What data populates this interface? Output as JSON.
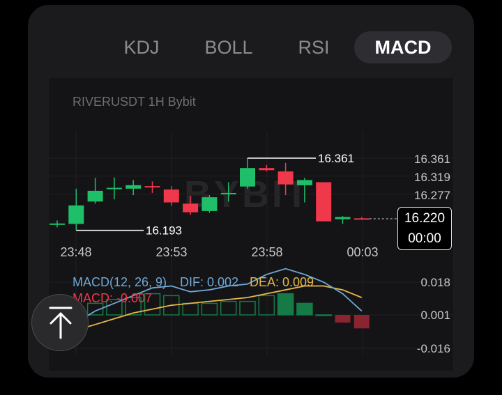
{
  "tabs": [
    {
      "label": "KDJ",
      "active": false
    },
    {
      "label": "BOLL",
      "active": false
    },
    {
      "label": "RSI",
      "active": false
    },
    {
      "label": "MACD",
      "active": true
    }
  ],
  "chart_header": {
    "symbol_label": "RIVERUSDT 1H Bybit"
  },
  "watermark": "BYBIT",
  "price_tag": {
    "price": "16.220",
    "countdown": "00:00"
  },
  "colors": {
    "up": "#1fbf6a",
    "down": "#f0384b",
    "dif": "#6ea9d6",
    "dea": "#e8b84a",
    "macd_label": "#f0384b"
  },
  "chart_data": [
    {
      "type": "candlestick",
      "title": "RIVERUSDT 1H Bybit",
      "x_ticks": [
        "23:48",
        "23:53",
        "23:58",
        "00:03"
      ],
      "y_ticks": [
        "16.361",
        "16.319",
        "16.277",
        "16.220"
      ],
      "high_label": "16.361",
      "low_label": "16.193",
      "candles": [
        {
          "o": 16.209,
          "h": 16.216,
          "l": 16.2,
          "c": 16.209
        },
        {
          "o": 16.208,
          "h": 16.29,
          "l": 16.193,
          "c": 16.251
        },
        {
          "o": 16.26,
          "h": 16.315,
          "l": 16.255,
          "c": 16.285
        },
        {
          "o": 16.292,
          "h": 16.316,
          "l": 16.265,
          "c": 16.292
        },
        {
          "o": 16.29,
          "h": 16.31,
          "l": 16.275,
          "c": 16.298
        },
        {
          "o": 16.296,
          "h": 16.307,
          "l": 16.28,
          "c": 16.293
        },
        {
          "o": 16.288,
          "h": 16.296,
          "l": 16.25,
          "c": 16.258
        },
        {
          "o": 16.255,
          "h": 16.273,
          "l": 16.229,
          "c": 16.235
        },
        {
          "o": 16.238,
          "h": 16.275,
          "l": 16.234,
          "c": 16.27
        },
        {
          "o": 16.28,
          "h": 16.305,
          "l": 16.26,
          "c": 16.28
        },
        {
          "o": 16.295,
          "h": 16.361,
          "l": 16.29,
          "c": 16.338
        },
        {
          "o": 16.338,
          "h": 16.345,
          "l": 16.33,
          "c": 16.333
        },
        {
          "o": 16.33,
          "h": 16.35,
          "l": 16.275,
          "c": 16.3
        },
        {
          "o": 16.298,
          "h": 16.315,
          "l": 16.258,
          "c": 16.31
        },
        {
          "o": 16.305,
          "h": 16.305,
          "l": 16.214,
          "c": 16.214
        },
        {
          "o": 16.219,
          "h": 16.226,
          "l": 16.208,
          "c": 16.224
        },
        {
          "o": 16.221,
          "h": 16.224,
          "l": 16.218,
          "c": 16.22
        }
      ]
    },
    {
      "type": "macd",
      "legend": {
        "params": "MACD(12, 26, 9)",
        "dif": "DIF: 0.002",
        "dea": "DEA: 0.009",
        "macd": "MACD: -0.007"
      },
      "y_ticks": [
        "0.018",
        "0.001",
        "-0.016"
      ],
      "dif": [
        -0.01,
        -0.004,
        0.002,
        0.006,
        0.01,
        0.014,
        0.015,
        0.012,
        0.013,
        0.015,
        0.016,
        0.021,
        0.024,
        0.021,
        0.017,
        0.011,
        0.002
      ],
      "dea": [
        -0.012,
        -0.008,
        -0.005,
        -0.002,
        0.001,
        0.003,
        0.005,
        0.006,
        0.007,
        0.008,
        0.009,
        0.011,
        0.013,
        0.015,
        0.015,
        0.013,
        0.009
      ],
      "histogram": [
        0.002,
        0.004,
        0.006,
        0.008,
        0.009,
        0.011,
        0.01,
        0.006,
        0.006,
        0.007,
        0.007,
        0.01,
        0.011,
        0.006,
        0.0,
        -0.004,
        -0.007
      ]
    }
  ]
}
